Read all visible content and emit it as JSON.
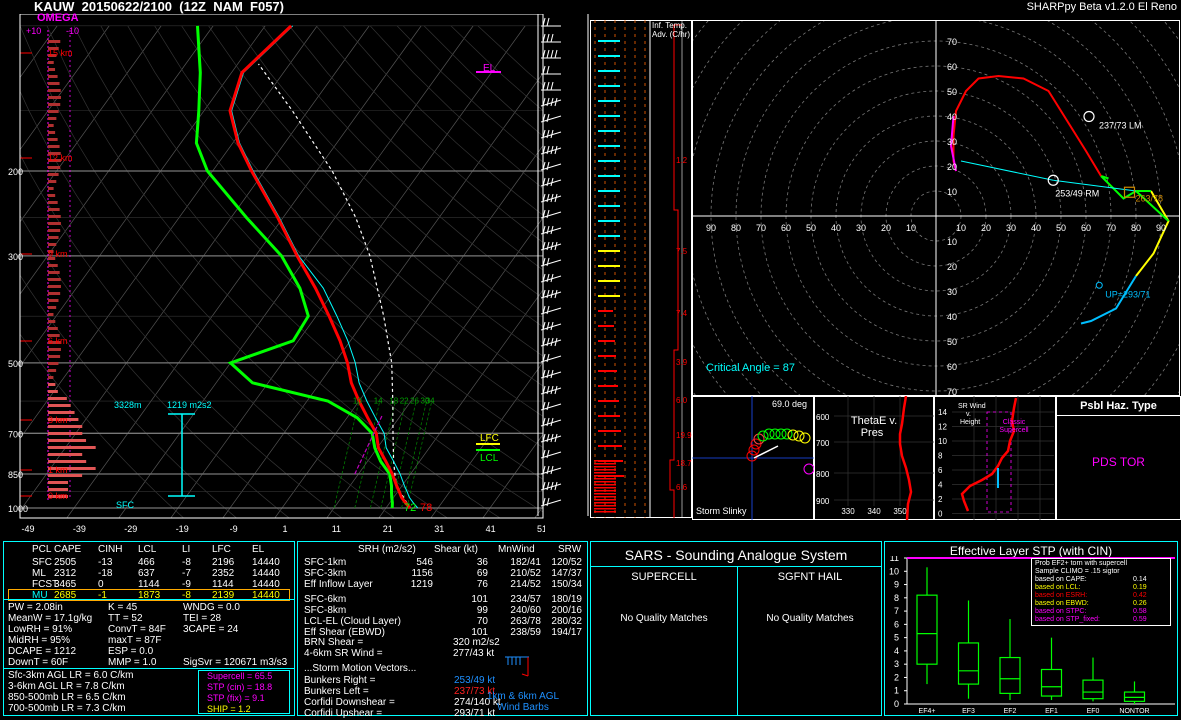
{
  "header": {
    "station_line": "KAUW  20150622/2100  (12Z  NAM  F057)",
    "app_title": "SHARPpy Beta v1.2.0 El Reno",
    "omega": "OMEGA",
    "omega_plus": "+10",
    "omega_minus": "-10"
  },
  "skewt": {
    "pressure_ticks": [
      "200",
      "300",
      "500",
      "700",
      "850",
      "1000"
    ],
    "temp_ticks": [
      "-49",
      "-39",
      "-29",
      "-19",
      "-9",
      "1",
      "11",
      "21",
      "31",
      "41",
      "51"
    ],
    "height_labels": [
      "15 km",
      "12 km",
      "9 km",
      "6 km",
      "3 km",
      "1 km",
      "0 km"
    ],
    "el_label": "EL",
    "lfc_label": "LFC",
    "lcl_label": "LCL",
    "sfc_label": "SFC",
    "eff_inflow_depth": "3328m",
    "eff_inflow_srh": "1219 m2s2",
    "sfc_temp": "78",
    "sfc_dewpoint": "72",
    "mixing_ratio_labels": [
      "10",
      "14",
      "18",
      "22",
      "26",
      "30",
      "34"
    ],
    "colors": {
      "temperature": "#ff0000",
      "dewpoint": "#00ff00",
      "virtual": "#00ffff",
      "parcel": "#ffffff",
      "el": "#ff00ff",
      "lfc": "#ffff00",
      "lcl": "#00ff00"
    }
  },
  "inferred_temp_adv": {
    "title_line1": "Inf. Temp.",
    "title_line2": "Adv. (C/hr)",
    "values": [
      "1.2",
      "7.5",
      "7.4",
      "3.9",
      "6.0",
      "19.9",
      "18.7",
      "6.6"
    ]
  },
  "hodograph": {
    "rings": [
      "10",
      "20",
      "30",
      "40",
      "50",
      "60",
      "70",
      "80",
      "90"
    ],
    "lm_label": "237/73 LM",
    "rm_label": "253/49 RM",
    "mean_label": "263/78",
    "up_label": "UP=293/71",
    "critical_angle": "Critical Angle = 87"
  },
  "storm_slinky": {
    "angle": "69.0 deg",
    "title": "Storm Slinky"
  },
  "thetae": {
    "title_line1": "ThetaE v.",
    "title_line2": "Pres",
    "y_ticks": [
      "600",
      "700",
      "800",
      "900"
    ],
    "x_ticks": [
      "330",
      "340",
      "350"
    ]
  },
  "sr_wind": {
    "title_line1": "SR Wind",
    "title_line2": "v.",
    "title_line3": "Height",
    "cloud_label_line1": "Classic",
    "cloud_label_line2": "Supercell",
    "y_ticks": [
      "14",
      "12",
      "10",
      "8",
      "6",
      "4",
      "2",
      "0"
    ]
  },
  "hazard": {
    "title": "Psbl Haz. Type",
    "value": "PDS TOR"
  },
  "parcels": {
    "headers": [
      "PCL",
      "CAPE",
      "CINH",
      "LCL",
      "LI",
      "LFC",
      "EL"
    ],
    "rows": [
      [
        "SFC",
        "2505",
        "-13",
        "466",
        "-8",
        "2196",
        "14440"
      ],
      [
        "ML",
        "2312",
        "-18",
        "637",
        "-7",
        "2352",
        "14440"
      ],
      [
        "FCST",
        "3465",
        "0",
        "1144",
        "-9",
        "1144",
        "14440"
      ],
      [
        "MU",
        "2685",
        "-1",
        "1873",
        "-8",
        "2139",
        "14440"
      ]
    ]
  },
  "indices": {
    "col1": [
      "PW = 2.08in",
      "MeanW = 17.1g/kg",
      "LowRH = 91%",
      "MidRH = 95%",
      "DCAPE = 1212",
      "DownT = 60F"
    ],
    "col2": [
      "K = 45",
      "TT = 52",
      "ConvT = 84F",
      "maxT = 87F",
      "ESP = 0.0",
      "MMP = 1.0"
    ],
    "col3": [
      "WNDG = 0.0",
      "TEI = 28",
      "3CAPE = 24",
      "",
      "",
      "SigSvr = 120671 m3/s3"
    ]
  },
  "lapse_rates": [
    "Sfc-3km AGL LR = 6.0 C/km",
    "3-6km AGL LR = 7.8 C/km",
    "850-500mb LR = 6.5 C/km",
    "700-500mb LR = 7.3 C/km"
  ],
  "composites": {
    "supercell": "Supercell = 65.5",
    "stp_cin": "STP (cin) = 18.8",
    "stp_fix": "STP (fix) = 9.1",
    "ship": "SHIP = 1.2"
  },
  "kinematics": {
    "headers": [
      "SRH (m2/s2)",
      "Shear (kt)",
      "MnWind",
      "SRW"
    ],
    "rows1": [
      [
        "SFC-1km",
        "546",
        "36",
        "182/41",
        "120/52"
      ],
      [
        "SFC-3km",
        "1156",
        "69",
        "210/52",
        "147/37"
      ],
      [
        "Eff Inflow Layer",
        "1219",
        "76",
        "214/52",
        "150/34"
      ]
    ],
    "rows2": [
      [
        "SFC-6km",
        "101",
        "234/57",
        "180/19"
      ],
      [
        "SFC-8km",
        "99",
        "240/60",
        "200/16"
      ],
      [
        "LCL-EL (Cloud Layer)",
        "70",
        "263/78",
        "280/32"
      ],
      [
        "Eff Shear (EBWD)",
        "101",
        "238/59",
        "194/17"
      ]
    ],
    "brn_shear_label": "BRN Shear =",
    "brn_shear": "320 m2/s2",
    "sr_wind_46_label": "4-6km SR Wind =",
    "sr_wind_46": "277/43 kt",
    "storm_motion_title": "...Storm Motion Vectors...",
    "motion_rows": [
      [
        "Bunkers Right =",
        "253/49 kt"
      ],
      [
        "Bunkers Left =",
        "237/73 kt"
      ],
      [
        "Corfidi Downshear =",
        "274/140 kt"
      ],
      [
        "Corfidi Upshear =",
        "293/71 kt"
      ]
    ],
    "wind_barbs_line1": "1km & 6km AGL",
    "wind_barbs_line2": "Wind Barbs"
  },
  "sars": {
    "title": "SARS - Sounding Analogue System",
    "supercell_header": "SUPERCELL",
    "hail_header": "SGFNT HAIL",
    "supercell_result": "No Quality Matches",
    "hail_result": "No Quality Matches"
  },
  "stp_panel": {
    "title": "Effective Layer STP (with CIN)",
    "legend_title_line1": "Prob EF2+ torn with supercell",
    "legend_title_line2": "Sample CLIMO = .15 sigtor",
    "legend": [
      [
        "based on CAPE:",
        "0.14",
        "#ffffff"
      ],
      [
        "based on LCL:",
        "0.19",
        "#ffff00"
      ],
      [
        "based on ESRH:",
        "0.42",
        "#ff0000"
      ],
      [
        "based on EBWD:",
        "0.26",
        "#ffff00"
      ],
      [
        "based on STPC:",
        "0.58",
        "#ff00ff"
      ],
      [
        "based on STP_fixed:",
        "0.59",
        "#ff00ff"
      ]
    ]
  },
  "chart_data": [
    {
      "type": "line",
      "title": "",
      "xlabel": "",
      "ylabel": "",
      "pressure_ticks_hpa": [
        200,
        300,
        500,
        700,
        850,
        1000
      ],
      "temp_ticks_c": [
        -49,
        -39,
        -29,
        -19,
        -9,
        1,
        11,
        21,
        31,
        41,
        51
      ],
      "series": [
        {
          "name": "",
          "role": "temperature",
          "color": "#ff0000",
          "pressure": [
            1000,
            975,
            950,
            925,
            900,
            850,
            800,
            750,
            700,
            650,
            600,
            550,
            500,
            450,
            400,
            350,
            300,
            250,
            200,
            175,
            150,
            125,
            100
          ],
          "value": [
            25.6,
            24.0,
            22.5,
            21.3,
            20.0,
            17.5,
            14.5,
            11.2,
            8.8,
            5.0,
            1.0,
            -3.0,
            -6.5,
            -11.0,
            -16.5,
            -23.0,
            -31.0,
            -40.0,
            -51.5,
            -58.0,
            -64.0,
            -67.0,
            -64.0
          ]
        },
        {
          "name": "",
          "role": "dewpoint",
          "color": "#00ff00",
          "pressure": [
            1000,
            975,
            950,
            925,
            900,
            850,
            800,
            750,
            700,
            650,
            600,
            550,
            500,
            450,
            400,
            350,
            300,
            250,
            200,
            175,
            150,
            125,
            100
          ],
          "value": [
            22.2,
            21.5,
            20.6,
            19.8,
            19.0,
            17.0,
            13.5,
            10.5,
            8.0,
            3.0,
            -5.0,
            -22.0,
            -29.0,
            -20.0,
            -20.5,
            -26.0,
            -34.0,
            -46.0,
            -60.0,
            -66.0,
            -70.0,
            -75.0,
            -82.0
          ]
        },
        {
          "name": "",
          "role": "parcel",
          "color": "#ffffff",
          "pressure": [
            1000,
            900,
            850,
            800,
            700,
            600,
            500,
            400,
            300,
            250,
            200,
            150,
            120
          ],
          "value": [
            25.6,
            20.0,
            18.0,
            16.0,
            12.0,
            7.5,
            2.0,
            -6.0,
            -17.0,
            -25.0,
            -36.0,
            -52.0,
            -65.0
          ]
        }
      ]
    },
    {
      "type": "scatter",
      "title": "",
      "xlabel": "",
      "ylabel": "",
      "ring_interval_kt": 10,
      "ring_max_kt": 90,
      "hodograph_uv_kt": [
        [
          84,
          21
        ],
        [
          82,
          26
        ],
        [
          78,
          34
        ],
        [
          72,
          40
        ],
        [
          65,
          46
        ],
        [
          55,
          53
        ],
        [
          42,
          56
        ],
        [
          30,
          57
        ],
        [
          20,
          55
        ],
        [
          12,
          50
        ],
        [
          7,
          42
        ],
        [
          6,
          30
        ],
        [
          6,
          20
        ]
      ],
      "points": [
        {
          "label": "237/73 LM",
          "u": 61.2,
          "v": 39.8
        },
        {
          "label": "253/49 RM",
          "u": 46.9,
          "v": 14.3
        },
        {
          "label": "263/78",
          "u": 77.4,
          "v": 9.5
        },
        {
          "label": "UP=293/71",
          "u": 65.3,
          "v": -27.7
        }
      ]
    },
    {
      "type": "bar",
      "title": "Effective Layer STP (with CIN)",
      "xlabel": "",
      "ylabel": "",
      "categories": [
        "EF4+",
        "EF3",
        "EF2",
        "EF1",
        "EF0",
        "NONTOR"
      ],
      "ylim": [
        0,
        11
      ],
      "y_ticks": [
        0,
        1,
        2,
        3,
        4,
        5,
        6,
        7,
        8,
        9,
        10,
        11
      ],
      "series": [
        {
          "name": "",
          "whisker_low": [
            1.5,
            0.4,
            0.3,
            0.3,
            0.2,
            0.0
          ],
          "q1": [
            3.0,
            1.5,
            0.8,
            0.6,
            0.4,
            0.2
          ],
          "median": [
            5.3,
            2.5,
            1.9,
            1.3,
            0.9,
            0.5
          ],
          "q3": [
            8.2,
            4.6,
            3.5,
            2.6,
            1.8,
            0.9
          ],
          "whisker_high": [
            10.3,
            7.8,
            6.4,
            5.0,
            3.5,
            1.7
          ]
        }
      ],
      "current_value": 11.0
    }
  ]
}
